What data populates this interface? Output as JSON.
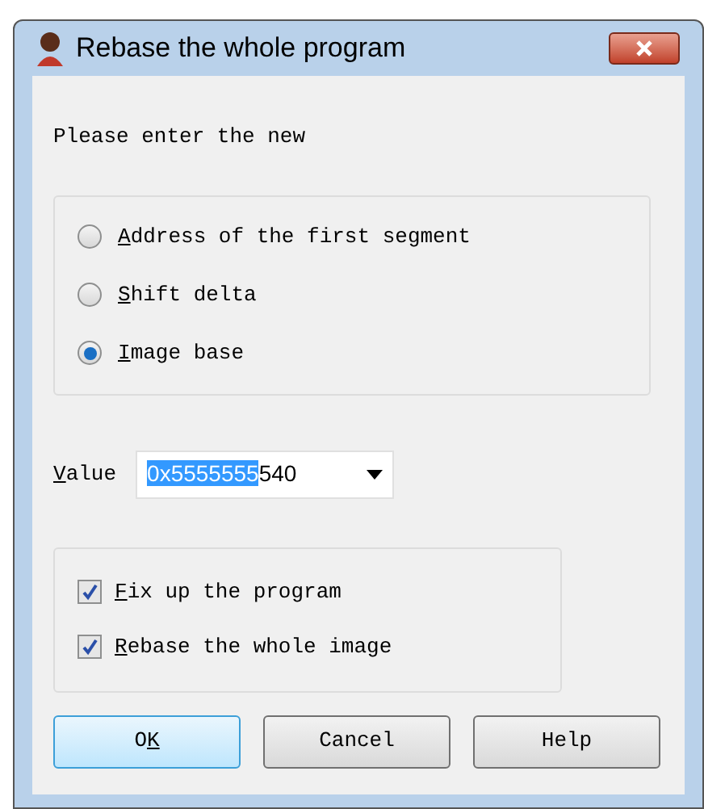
{
  "window": {
    "title": "Rebase the whole program"
  },
  "prompt": "Please enter the new",
  "options": [
    {
      "access_key": "A",
      "label_end": "ddress of the first segment",
      "selected": false
    },
    {
      "access_key": "S",
      "label_end": "hift delta",
      "selected": false
    },
    {
      "access_key": "I",
      "label_end": "mage base",
      "selected": true
    }
  ],
  "value_field": {
    "access_key": "V",
    "label_end": "alue",
    "selected_text": "0x5555555",
    "rest_text": "540"
  },
  "checks": [
    {
      "access_key": "F",
      "label_end": "ix up the program",
      "checked": true
    },
    {
      "access_key": "R",
      "label_end": "ebase the whole image",
      "checked": true
    }
  ],
  "buttons": [
    {
      "label_start": "O",
      "access_key": "K",
      "default": true
    },
    {
      "label_start": "Cancel",
      "default": false
    },
    {
      "label_start": "Help",
      "default": false
    }
  ]
}
